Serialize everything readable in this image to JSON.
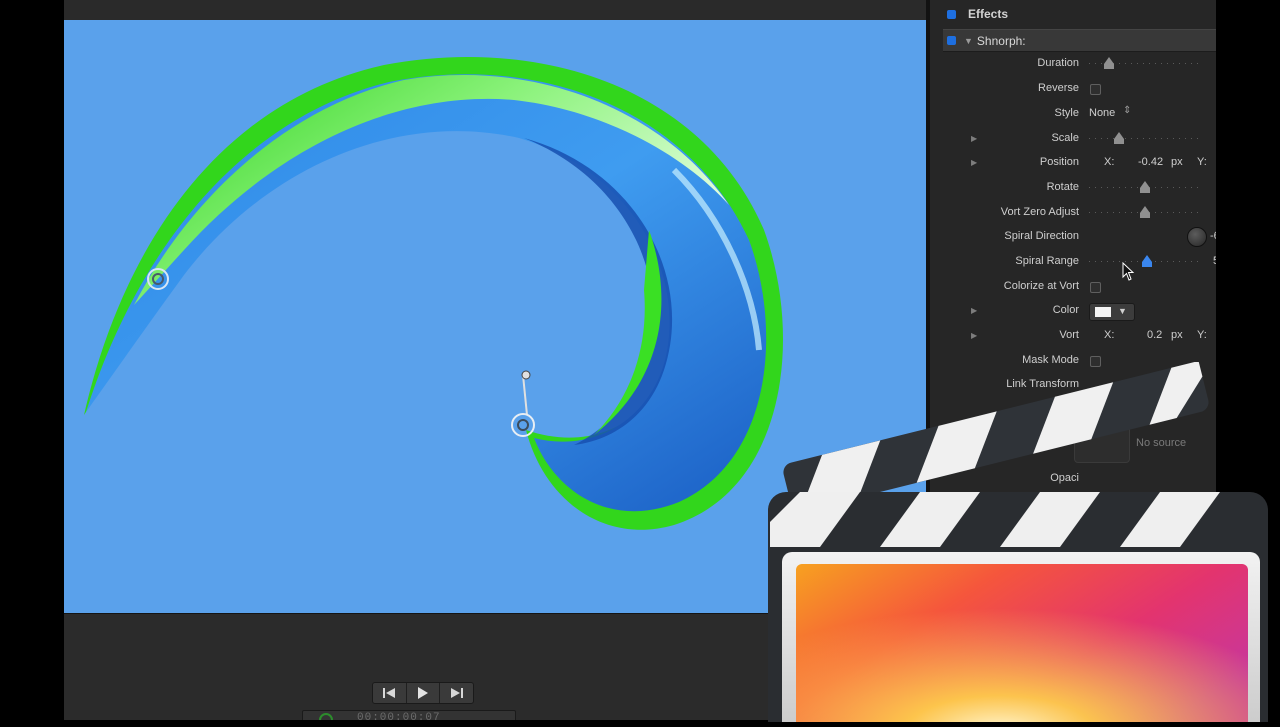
{
  "inspector": {
    "section_title": "Effects",
    "effect_name": "Shnorph:",
    "params": {
      "duration": {
        "label": "Duration",
        "level": 0.18
      },
      "reverse": {
        "label": "Reverse"
      },
      "style": {
        "label": "Style",
        "value": "None"
      },
      "scale": {
        "label": "Scale",
        "level": 0.27
      },
      "position": {
        "label": "Position",
        "x_label": "X:",
        "x_value": "-0.42",
        "x_unit": "px",
        "y_label": "Y:"
      },
      "rotate": {
        "label": "Rotate",
        "level": 0.5
      },
      "vort_zero_adjust": {
        "label": "Vort Zero Adjust",
        "level": 0.5
      },
      "spiral_direction": {
        "label": "Spiral Direction",
        "value_partial": "-6"
      },
      "spiral_range": {
        "label": "Spiral Range",
        "level": 0.52,
        "value_partial": "5"
      },
      "colorize_at_vort": {
        "label": "Colorize at Vort"
      },
      "color": {
        "label": "Color",
        "swatch": "#f4f4f4"
      },
      "vort": {
        "label": "Vort",
        "x_label": "X:",
        "x_value": "0.2",
        "x_unit": "px",
        "y_label": "Y:"
      },
      "mask_mode": {
        "label": "Mask Mode"
      },
      "link_transform": {
        "label": "Link Transform"
      },
      "opacity_partial": {
        "label": "Opaci"
      }
    },
    "source_well_text": "No source"
  },
  "viewer": {
    "background_color": "#5aa1eb",
    "timecode": "00:00:00:07"
  },
  "icons": [
    "go-to-start-icon",
    "play-icon",
    "go-to-end-icon",
    "final-cut-pro-clapper-icon",
    "pointer-cursor-icon"
  ],
  "colors": {
    "accent_blue": "#1e6fe0",
    "swirl_green": "#32d61c",
    "swirl_blue": "#1f6fd0"
  }
}
